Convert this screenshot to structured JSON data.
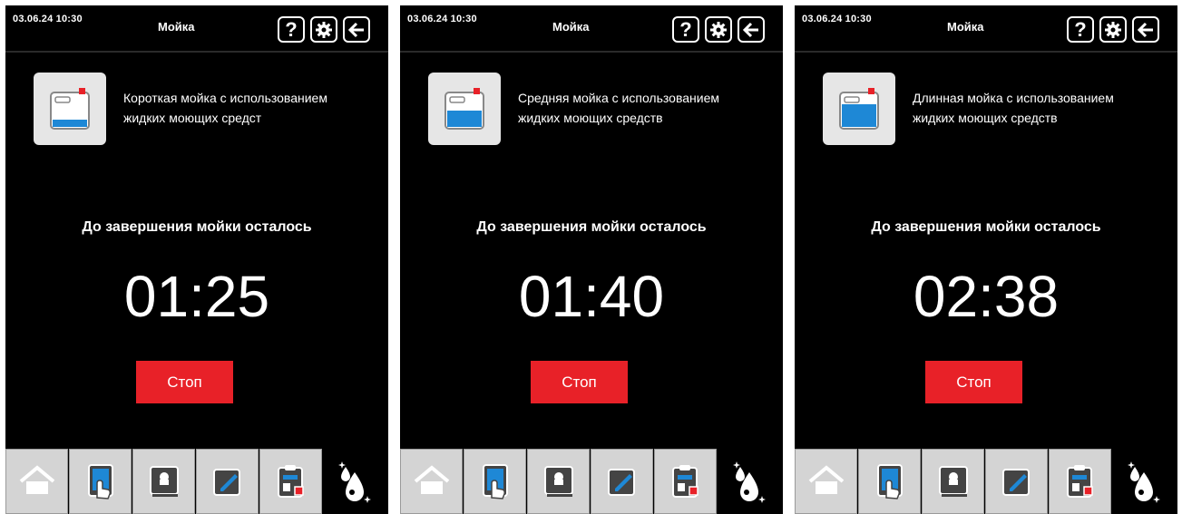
{
  "screens": [
    {
      "datetime": "03.06.24 10:30",
      "title": "Мойка",
      "description_line1": "Короткая мойка с использованием",
      "description_line2": "жидких моющих средст",
      "remaining_label": "До завершения мойки осталось",
      "timer": "01:25",
      "stop_label": "Стоп",
      "canister_fill": 0.25
    },
    {
      "datetime": "03.06.24 10:30",
      "title": "Мойка",
      "description_line1": "Средняя  мойка с использованием",
      "description_line2": "жидких моющих средств",
      "remaining_label": "До завершения мойки осталось",
      "timer": "01:40",
      "stop_label": "Стоп",
      "canister_fill": 0.5
    },
    {
      "datetime": "03.06.24 10:30",
      "title": "Мойка",
      "description_line1": "Длинная мойка с использованием",
      "description_line2": "жидких моющих средств",
      "remaining_label": "До завершения мойки осталось",
      "timer": "02:38",
      "stop_label": "Стоп",
      "canister_fill": 0.85
    }
  ],
  "header_icons": [
    "help-icon",
    "gear-icon",
    "back-arrow-icon"
  ],
  "nav_icons": [
    "home-icon",
    "touch-tablet-icon",
    "recipe-book-icon",
    "edit-icon",
    "clipboard-icon",
    "wash-drops-icon"
  ],
  "colors": {
    "background": "#000000",
    "stop_button": "#e82128",
    "nav_button": "#d4d4d4",
    "detergent_blue": "#1e88d6",
    "active_wash_icon": "#ffffff"
  }
}
